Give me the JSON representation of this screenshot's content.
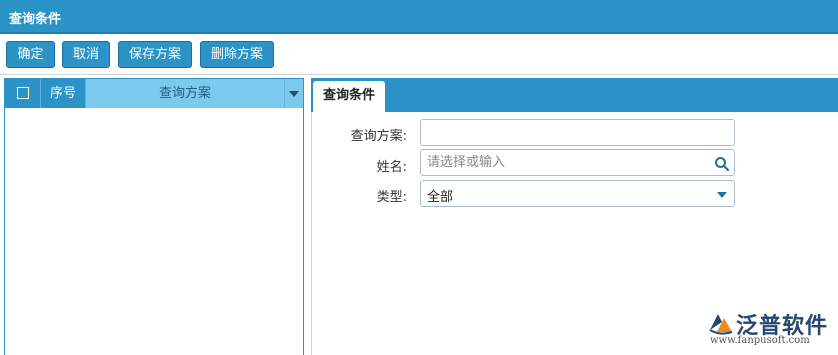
{
  "window": {
    "title": "查询条件"
  },
  "toolbar": {
    "confirm_label": "确定",
    "cancel_label": "取消",
    "save_plan_label": "保存方案",
    "delete_plan_label": "删除方案"
  },
  "plan_list": {
    "columns": {
      "seq": "序号",
      "plan": "查询方案"
    },
    "rows": []
  },
  "conditions": {
    "tab_label": "查询条件",
    "fields": {
      "plan": {
        "label": "查询方案:",
        "value": ""
      },
      "name": {
        "label": "姓名:",
        "placeholder": "请选择或输入",
        "value": ""
      },
      "type": {
        "label": "类型:",
        "value": "全部"
      }
    }
  },
  "logo": {
    "name": "泛普软件",
    "url": "www.fanpusoft.com"
  },
  "colors": {
    "accent": "#2b93c5",
    "header_highlight": "#7cc9ee",
    "logo_orange": "#f08a24",
    "logo_blue": "#24486f"
  }
}
